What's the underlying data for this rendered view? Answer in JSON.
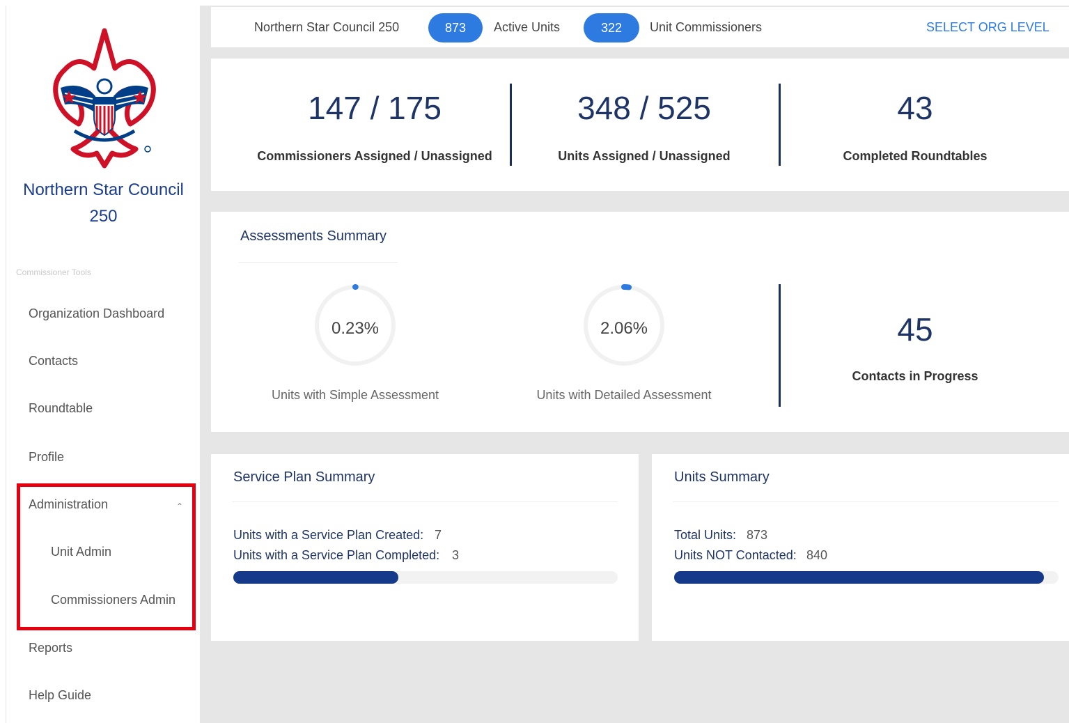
{
  "sidebar": {
    "council_line1": "Northern Star Council",
    "council_line2": "250",
    "section_label": "Commissioner Tools",
    "items": [
      {
        "label": "Organization Dashboard"
      },
      {
        "label": "Contacts"
      },
      {
        "label": "Roundtable"
      },
      {
        "label": "Profile"
      },
      {
        "label": "Administration"
      },
      {
        "label": "Unit Admin"
      },
      {
        "label": "Commissioners Admin"
      },
      {
        "label": "Reports"
      },
      {
        "label": "Help Guide"
      }
    ],
    "admin_chevron_icon": "chevron-up-icon"
  },
  "header": {
    "council": "Northern Star Council 250",
    "active_units_count": "873",
    "active_units_label": "Active Units",
    "unit_commissioners_count": "322",
    "unit_commissioners_label": "Unit Commissioners",
    "select_org_level": "SELECT ORG LEVEL"
  },
  "stats": [
    {
      "value": "147 / 175",
      "label": "Commissioners Assigned / Unassigned"
    },
    {
      "value": "348 / 525",
      "label": "Units Assigned / Unassigned"
    },
    {
      "value": "43",
      "label": "Completed Roundtables"
    }
  ],
  "assessments": {
    "title": "Assessments Summary",
    "simple": {
      "value": "0.23%",
      "label": "Units with Simple Assessment",
      "fraction": 0.0023
    },
    "detailed": {
      "value": "2.06%",
      "label": "Units with Detailed Assessment",
      "fraction": 0.0206
    },
    "contacts_value": "45",
    "contacts_label": "Contacts in Progress"
  },
  "service_plan": {
    "title": "Service Plan Summary",
    "created_label": "Units with a Service Plan Created:",
    "created_value": "7",
    "completed_label": "Units with a Service Plan Completed:",
    "completed_value": "3",
    "progress_fraction": 0.43
  },
  "units_summary": {
    "title": "Units Summary",
    "total_label": "Total Units:",
    "total_value": "873",
    "not_contacted_label": "Units NOT Contacted:",
    "not_contacted_value": "840",
    "progress_fraction": 0.962
  },
  "colors": {
    "accent_blue": "#2d7be0",
    "navy": "#1f3466",
    "progress_fill": "#163a8a",
    "highlight_red": "#e40010",
    "logo_red": "#ce1126",
    "logo_blue": "#003f87"
  }
}
